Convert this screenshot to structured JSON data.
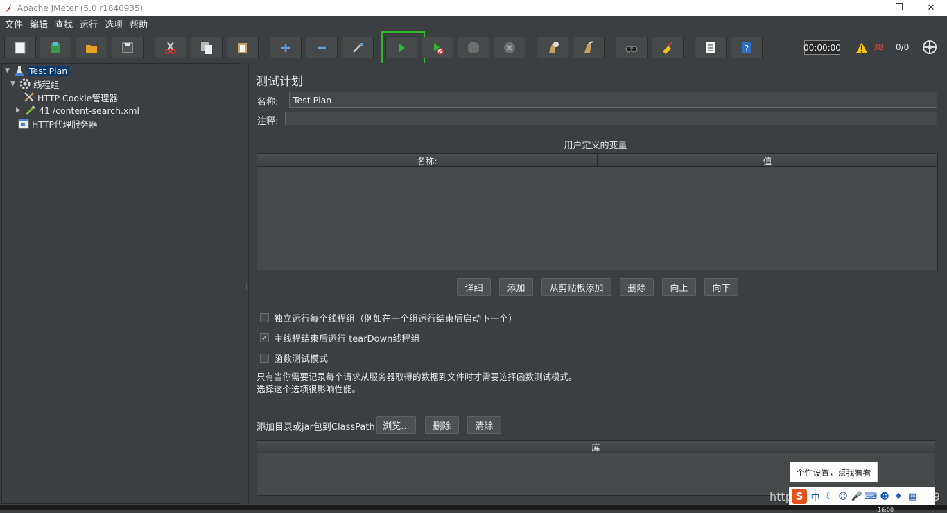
{
  "window": {
    "title": "Apache JMeter (5.0 r1840935)",
    "minimize": "—",
    "maximize": "❐",
    "close": "✕"
  },
  "menu": [
    "文件",
    "编辑",
    "查找",
    "运行",
    "选项",
    "帮助"
  ],
  "toolbar": {
    "timer": "00:00:00",
    "warning_count": "38",
    "thread_count": "0/0",
    "highlight_color": "#2fb82f"
  },
  "tree": {
    "nodes": [
      {
        "label": "Test Plan",
        "icon": "test-plan-icon"
      },
      {
        "label": "线程组",
        "icon": "thread-group-gear-icon"
      },
      {
        "label": "HTTP Cookie管理器",
        "icon": "cookie-manager-tools-icon"
      },
      {
        "label": "41 /content-search.xml",
        "icon": "http-sampler-pipette-icon"
      },
      {
        "label": "HTTP代理服务器",
        "icon": "proxy-server-icon"
      }
    ]
  },
  "main": {
    "title": "测试计划",
    "name_label": "名称:",
    "name_value": "Test Plan",
    "comment_label": "注释:",
    "comment_value": "",
    "vars_title": "用户定义的变量",
    "vars_columns": [
      "名称:",
      "值"
    ],
    "vars_buttons": [
      "详细",
      "添加",
      "从剪贴板添加",
      "删除",
      "向上",
      "向下"
    ],
    "options": [
      {
        "label": "独立运行每个线程组（例如在一个组运行结束后启动下一个）",
        "checked": false
      },
      {
        "label": "主线程结束后运行 tearDown线程组",
        "checked": true
      },
      {
        "label": "函数测试模式",
        "checked": false
      }
    ],
    "note_lines": [
      "只有当你需要记录每个请求从服务器取得的数据到文件时才需要选择函数测试模式。",
      "选择这个选项很影响性能。"
    ],
    "classpath_label": "添加目录或jar包到ClassPath",
    "classpath_buttons": [
      "浏览...",
      "删除",
      "清除"
    ],
    "lib_column": "库"
  },
  "overlay": {
    "tooltip": "个性设置，点我看看",
    "ime_logo": "S",
    "ime_mode": "中",
    "watermark": "https",
    "watermark_end": "9",
    "clock": "16:00"
  },
  "check_mark": "✓",
  "splitter_grip": "⋮"
}
